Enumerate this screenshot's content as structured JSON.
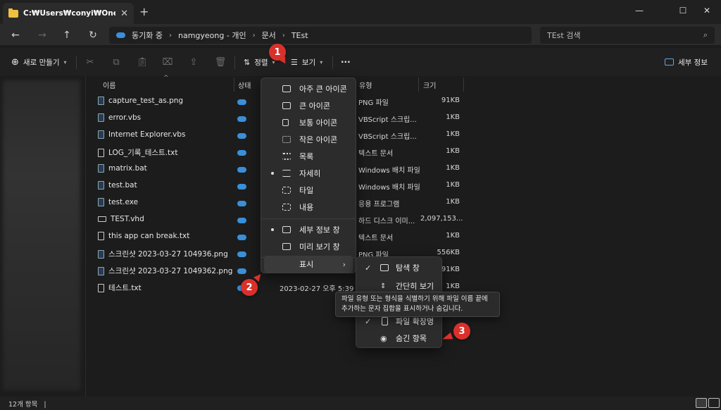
{
  "window": {
    "tab_title": "C:₩Users₩conyi₩OneDrive₩",
    "new_tab": "+",
    "minimize": "—",
    "maximize": "☐",
    "close": "✕"
  },
  "nav": {
    "breadcrumbs": [
      "동기화 중",
      "namgyeong - 개인",
      "문서",
      "TEst"
    ],
    "search_placeholder": "TEst 검색"
  },
  "toolbar": {
    "new_label": "새로 만들기",
    "sort_label": "정렬",
    "view_label": "보기",
    "more_label": "···",
    "details_label": "세부 정보"
  },
  "columns": {
    "name": "이름",
    "status": "상태",
    "type": "유형",
    "size": "크기"
  },
  "files": [
    {
      "name": "capture_test_as.png",
      "type": "PNG 파일",
      "size": "91KB"
    },
    {
      "name": "error.vbs",
      "type": "VBScript 스크립...",
      "size": "1KB"
    },
    {
      "name": "Internet Explorer.vbs",
      "type": "VBScript 스크립...",
      "size": "1KB"
    },
    {
      "name": "LOG_기록_테스트.txt",
      "type": "텍스트 문서",
      "size": "1KB"
    },
    {
      "name": "matrix.bat",
      "type": "Windows 배치 파일",
      "size": "1KB"
    },
    {
      "name": "test.bat",
      "type": "Windows 배치 파일",
      "size": "1KB"
    },
    {
      "name": "test.exe",
      "type": "응용 프로그램",
      "size": "1KB"
    },
    {
      "name": "TEST.vhd",
      "type": "하드 디스크 이미...",
      "size": "2,097,153..."
    },
    {
      "name": "this app can break.txt",
      "type": "텍스트 문서",
      "size": "1KB"
    },
    {
      "name": "스크린샷 2023-03-27 104936.png",
      "type": "PNG 파일",
      "size": "556KB"
    },
    {
      "name": "스크린샷 2023-03-27 1049362.png",
      "type": "",
      "size": "91KB"
    },
    {
      "name": "테스트.txt",
      "date": "2023-02-27 오후 5:39",
      "type": "",
      "size": "1KB"
    }
  ],
  "view_menu": {
    "items": [
      {
        "label": "아주 큰 아이콘",
        "selected": false
      },
      {
        "label": "큰 아이콘",
        "selected": false
      },
      {
        "label": "보통 아이콘",
        "selected": false
      },
      {
        "label": "작은 아이콘",
        "selected": false
      },
      {
        "label": "목록",
        "selected": false
      },
      {
        "label": "자세히",
        "selected": true
      },
      {
        "label": "타일",
        "selected": false
      },
      {
        "label": "내용",
        "selected": false
      },
      {
        "label": "세부 정보 창",
        "selected": true
      },
      {
        "label": "미리 보기 창",
        "selected": false
      }
    ],
    "show_label": "표시",
    "show_arrow": "›"
  },
  "show_submenu": {
    "items": [
      {
        "label": "탐색 창",
        "checked": true
      },
      {
        "label": "간단히 보기",
        "checked": false
      },
      {
        "label": "파일 확장명",
        "checked": true
      },
      {
        "label": "숨긴 항목",
        "checked": false
      }
    ]
  },
  "tooltip": "파일 유형 또는 형식을 식별하기 위해 파일 이름 끝에 추가하는 문자 집합을 표시하거나 숨깁니다.",
  "markers": [
    "1",
    "2",
    "3"
  ],
  "status": {
    "item_count": "12개 항목",
    "cursor": "|"
  },
  "colors": {
    "marker": "#d9302c",
    "cloud": "#3a8fd9",
    "folder": "#f0c040"
  }
}
